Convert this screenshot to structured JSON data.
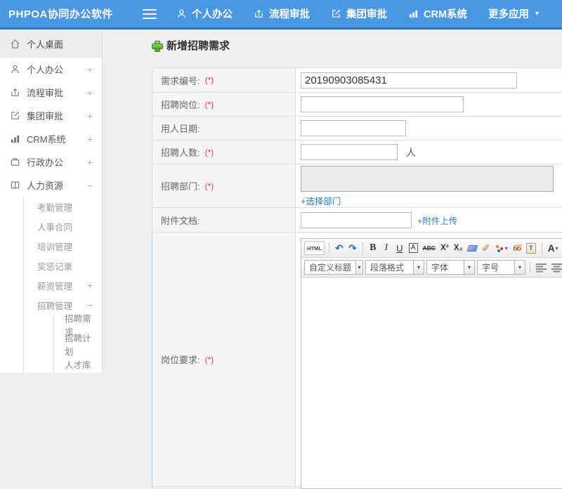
{
  "topbar": {
    "brand": "PHPOA协同办公软件",
    "nav": [
      {
        "label": "个人办公"
      },
      {
        "label": "流程审批"
      },
      {
        "label": "集团审批"
      },
      {
        "label": "CRM系统"
      },
      {
        "label": "更多应用"
      }
    ]
  },
  "sidebar": {
    "items": [
      {
        "label": "个人桌面"
      },
      {
        "label": "个人办公",
        "expander": "+"
      },
      {
        "label": "流程审批",
        "expander": "+"
      },
      {
        "label": "集团审批",
        "expander": "+"
      },
      {
        "label": "CRM系统",
        "expander": "+"
      },
      {
        "label": "行政办公",
        "expander": "+"
      },
      {
        "label": "人力资源",
        "expander": "−"
      }
    ],
    "hr_sub": [
      {
        "label": "考勤管理"
      },
      {
        "label": "人事合同"
      },
      {
        "label": "培训管理"
      },
      {
        "label": "奖惩记录"
      },
      {
        "label": "薪资管理",
        "expander": "+"
      },
      {
        "label": "招聘管理",
        "expander": "−"
      }
    ],
    "recruit_sub": [
      {
        "label": "招聘需求"
      },
      {
        "label": "招聘计划"
      },
      {
        "label": "人才库"
      }
    ]
  },
  "page": {
    "title": "新增招聘需求"
  },
  "form": {
    "rows": [
      {
        "label": "需求编号:",
        "required": "(*)",
        "value": "20190903085431"
      },
      {
        "label": "招聘岗位:",
        "required": "(*)"
      },
      {
        "label": "用人日期:"
      },
      {
        "label": "招聘人数:",
        "required": "(*)",
        "suffix": "人"
      },
      {
        "label": "招聘部门:",
        "required": "(*)",
        "link": "+选择部门"
      },
      {
        "label": "附件文档:",
        "link": "+附件上传"
      },
      {
        "label": "岗位要求:",
        "required": "(*)"
      }
    ]
  },
  "editor": {
    "toolbar": {
      "html": "HTML",
      "undo": "↶",
      "redo": "↷",
      "bold": "B",
      "italic": "I",
      "underline": "U",
      "anchor": "A",
      "strike": "ABC",
      "sup": "X²",
      "sub": "X₂",
      "quote": "66",
      "paste_t": "T",
      "fontcolor": "A",
      "backcolor": "a"
    },
    "dropdowns": [
      {
        "label": "自定义标题"
      },
      {
        "label": "段落格式"
      },
      {
        "label": "字体"
      },
      {
        "label": "字号"
      }
    ]
  },
  "icons": {
    "caret_down": "▾"
  },
  "colors": {
    "topbar": "#4a97e4",
    "topbar_strip": "#3472bd",
    "link": "#2e7fc0",
    "required": "#e23b3b",
    "plus": "#4ea52e"
  }
}
